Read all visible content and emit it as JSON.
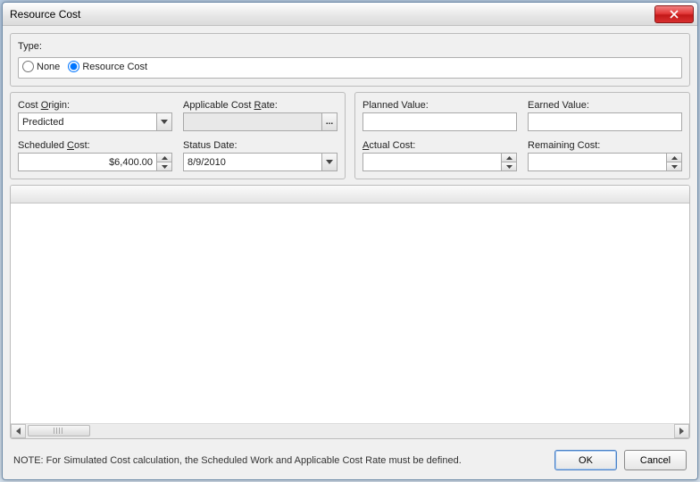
{
  "window": {
    "title": "Resource Cost"
  },
  "type_section": {
    "label": "Type:",
    "options": {
      "none": "None",
      "resource_cost": "Resource Cost"
    },
    "selected": "resource_cost"
  },
  "left_panel": {
    "cost_origin": {
      "label_pre": "Cost ",
      "label_u": "O",
      "label_post": "rigin:",
      "value": "Predicted"
    },
    "applicable_rate": {
      "label_pre": "Applicable Cost ",
      "label_u": "R",
      "label_post": "ate:",
      "value": "",
      "browse_label": "..."
    },
    "scheduled_cost": {
      "label_pre": "Scheduled ",
      "label_u": "C",
      "label_post": "ost:",
      "value": "$6,400.00"
    },
    "status_date": {
      "label": "Status Date:",
      "value": "8/9/2010"
    }
  },
  "right_panel": {
    "planned_value": {
      "label": "Planned Value:",
      "value": ""
    },
    "earned_value": {
      "label": "Earned Value:",
      "value": ""
    },
    "actual_cost": {
      "label_u": "A",
      "label_post": "ctual Cost:",
      "value": ""
    },
    "remaining_cost": {
      "label_pre": "Remainin",
      "label_u": "g",
      "label_post": " Cost:",
      "value": ""
    }
  },
  "footer": {
    "note": "NOTE: For Simulated Cost calculation, the Scheduled Work and Applicable Cost Rate must be defined.",
    "ok": "OK",
    "cancel": "Cancel"
  }
}
